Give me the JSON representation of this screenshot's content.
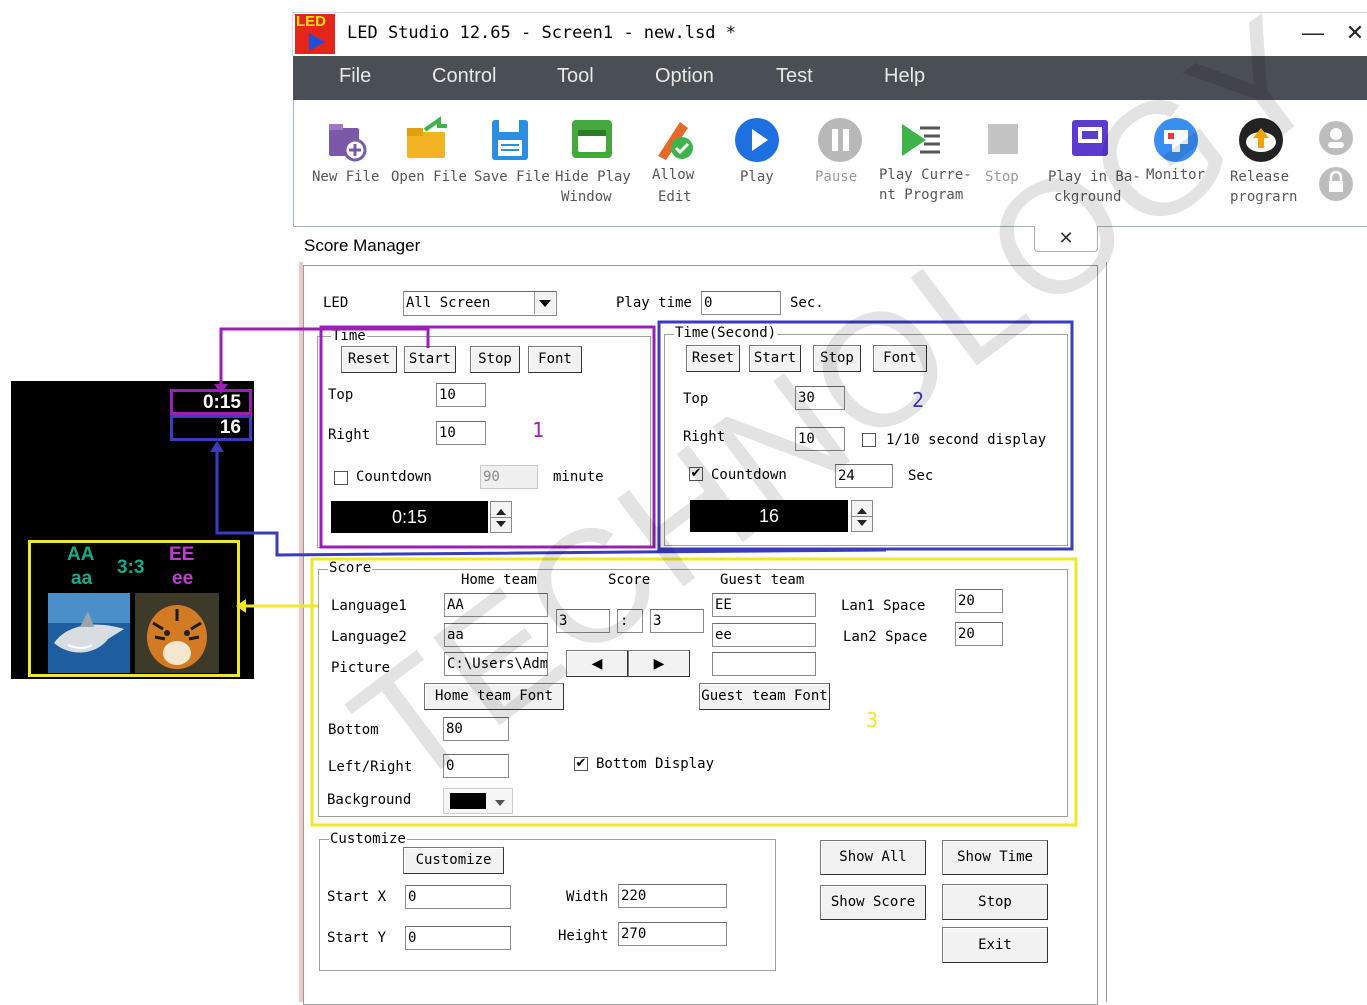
{
  "window": {
    "title": "LED Studio 12.65 - Screen1 - new.lsd *",
    "logo_text": "LED",
    "minimize": "—",
    "close": "✕"
  },
  "menu": [
    "File",
    "Control",
    "Tool",
    "Option",
    "Test",
    "Help"
  ],
  "toolbar": {
    "items": [
      {
        "label1": "New File",
        "label2": "",
        "icon": "new-file-icon"
      },
      {
        "label1": "Open File",
        "label2": "",
        "icon": "open-folder-icon"
      },
      {
        "label1": "Save File",
        "label2": "",
        "icon": "save-disk-icon"
      },
      {
        "label1": "Hide Play",
        "label2": "Window",
        "icon": "hide-window-icon"
      },
      {
        "label1": "Allow",
        "label2": "Edit",
        "icon": "allow-edit-icon"
      },
      {
        "label1": "Play",
        "label2": "",
        "icon": "play-icon"
      },
      {
        "label1": "Pause",
        "label2": "",
        "icon": "pause-icon"
      },
      {
        "label1": "Play Curre-",
        "label2": "nt Program",
        "icon": "play-current-icon"
      },
      {
        "label1": "Stop",
        "label2": "",
        "icon": "stop-icon"
      },
      {
        "label1": "Play in Ba-",
        "label2": "ckground",
        "icon": "background-play-icon"
      },
      {
        "label1": "Monitor",
        "label2": "",
        "icon": "monitor-icon"
      },
      {
        "label1": "Release",
        "label2": "prograrn",
        "icon": "upload-cloud-icon"
      }
    ]
  },
  "dialog": {
    "title": "Score Manager",
    "close": "✕",
    "led_label": "LED",
    "led_value": "All Screen",
    "play_time_label": "Play time",
    "play_time_value": "0",
    "play_time_unit": "Sec.",
    "time_group": {
      "title": "Time",
      "buttons": [
        "Reset",
        "Start",
        "Stop",
        "Font"
      ],
      "top_label": "Top",
      "top_value": "10",
      "right_label": "Right",
      "right_value": "10",
      "marker": "1",
      "countdown_label": "Countdown",
      "countdown_checked": false,
      "countdown_value": "90",
      "countdown_unit": "minute",
      "display": "0:15"
    },
    "time_second_group": {
      "title": "Time(Second)",
      "buttons": [
        "Reset",
        "Start",
        "Stop",
        "Font"
      ],
      "top_label": "Top",
      "top_value": "30",
      "marker": "2",
      "right_label": "Right",
      "right_value": "10",
      "tenth_label": "1/10 second display",
      "tenth_checked": false,
      "countdown_label": "Countdown",
      "countdown_checked": true,
      "countdown_value": "24",
      "countdown_unit": "Sec",
      "display": "16"
    },
    "score_group": {
      "title": "Score",
      "home_header": "Home team",
      "score_header": "Score",
      "guest_header": "Guest team",
      "language1_label": "Language1",
      "language2_label": "Language2",
      "picture_label": "Picture",
      "home_lang1": "AA",
      "home_lang2": "aa",
      "home_picture": "C:\\Users\\Adm",
      "score_home": "3",
      "score_sep": ":",
      "score_guest": "3",
      "guest_lang1": "EE",
      "guest_lang2": "ee",
      "guest_picture": "",
      "lan1_space_label": "Lan1 Space",
      "lan1_space_value": "20",
      "lan2_space_label": "Lan2 Space",
      "lan2_space_value": "20",
      "home_font_btn": "Home team Font",
      "guest_font_btn": "Guest team Font",
      "marker": "3",
      "bottom_label": "Bottom",
      "bottom_value": "80",
      "leftright_label": "Left/Right",
      "leftright_value": "0",
      "bottom_display_label": "Bottom Display",
      "bottom_display_checked": true,
      "background_label": "Background",
      "background_color": "#000000"
    },
    "customize_group": {
      "title": "Customize",
      "button": "Customize",
      "startx_label": "Start X",
      "startx_value": "0",
      "starty_label": "Start Y",
      "starty_value": "0",
      "width_label": "Width",
      "width_value": "220",
      "height_label": "Height",
      "height_value": "270"
    },
    "right_buttons": {
      "show_all": "Show All",
      "show_time": "Show Time",
      "show_score": "Show Score",
      "stop": "Stop",
      "exit": "Exit"
    }
  },
  "preview": {
    "time": "0:15",
    "seconds": "16",
    "home1": "AA",
    "home2": "aa",
    "score": "3:3",
    "guest1": "EE",
    "guest2": "ee"
  },
  "watermark": "TECHNOLOGY",
  "colors": {
    "time_box": "#9b1fb5",
    "second_box": "#3b3bbd",
    "score_box": "#f0e62a",
    "menubar": "#4a4e55",
    "led_bg": "#000000",
    "play_blue": "#1e6fe0"
  }
}
